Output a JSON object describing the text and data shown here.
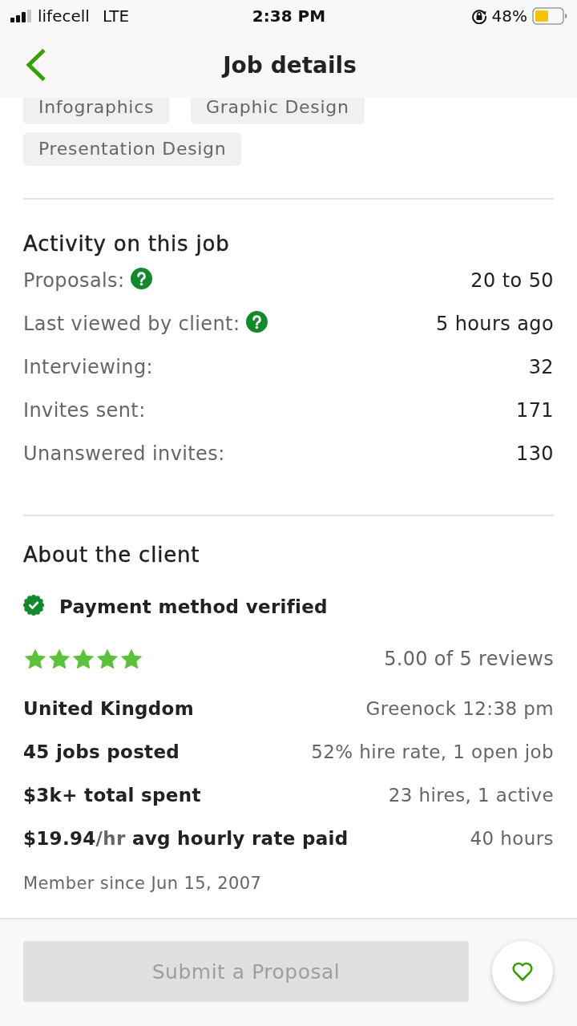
{
  "status_bar": {
    "carrier": "lifecell",
    "network": "LTE",
    "time": "2:38 PM",
    "battery": "48%"
  },
  "nav": {
    "title": "Job details"
  },
  "skills": [
    "Infographics",
    "Graphic Design",
    "Presentation Design"
  ],
  "activity": {
    "title": "Activity on this job",
    "rows": [
      {
        "label": "Proposals:",
        "help": true,
        "value": "20 to 50"
      },
      {
        "label": "Last viewed by client:",
        "help": true,
        "value": "5 hours ago"
      },
      {
        "label": "Interviewing:",
        "help": false,
        "value": "32"
      },
      {
        "label": "Invites sent:",
        "help": false,
        "value": "171"
      },
      {
        "label": "Unanswered invites:",
        "help": false,
        "value": "130"
      }
    ]
  },
  "client": {
    "title": "About the client",
    "payment": {
      "label": "Payment method verified",
      "verified": true
    },
    "rating": {
      "stars": 5,
      "text": "5.00 of 5 reviews"
    },
    "rows": [
      {
        "label": "United Kingdom",
        "value": "Greenock 12:38 pm"
      },
      {
        "label": "45 jobs posted",
        "value": "52% hire rate, 1 open job"
      },
      {
        "label": "$3k+ total spent",
        "value": "23 hires, 1 active"
      },
      {
        "label_parts": [
          {
            "text": "$19.94",
            "muted": false
          },
          {
            "text": "/hr",
            "muted": true
          },
          {
            "text": " avg hourly rate paid",
            "muted": false
          }
        ],
        "value": "40 hours"
      }
    ],
    "member_since": "Member since Jun 15, 2007"
  },
  "footer": {
    "submit": {
      "label": "Submit a Proposal",
      "disabled": true
    },
    "saved": false
  }
}
